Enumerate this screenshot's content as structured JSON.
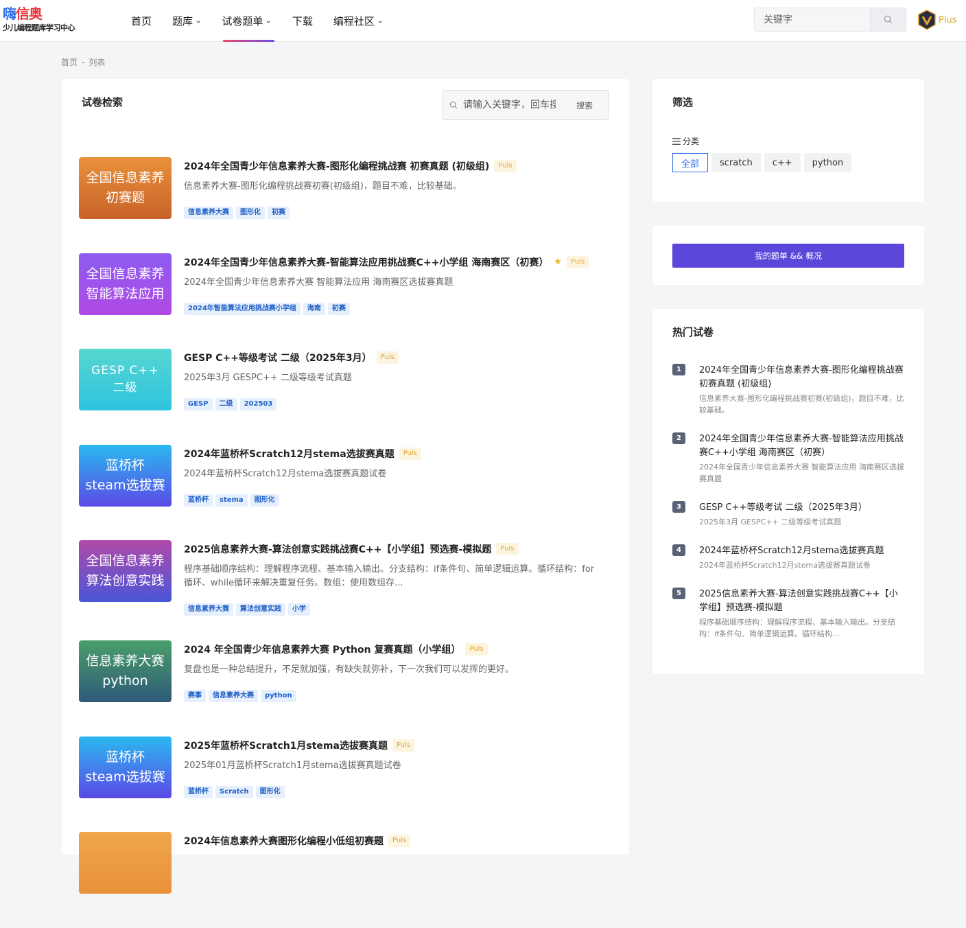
{
  "header": {
    "logo_main_1": "嗨",
    "logo_main_2": "信奥",
    "logo_sub": "少儿编程题库学习中心",
    "nav": [
      {
        "label": "首页",
        "has_menu": false
      },
      {
        "label": "题库",
        "has_menu": true
      },
      {
        "label": "试卷题单",
        "has_menu": true
      },
      {
        "label": "下载",
        "has_menu": false
      },
      {
        "label": "编程社区",
        "has_menu": true
      }
    ],
    "search_placeholder": "关键字",
    "plus_label": "Plus"
  },
  "breadcrumb": {
    "home": "首页",
    "sep": "-",
    "current": "列表"
  },
  "main": {
    "title": "试卷检索",
    "search_placeholder": "请输入关键字，回车搜",
    "search_button": "搜索",
    "items": [
      {
        "thumb": [
          "全国信息素养",
          "初赛题"
        ],
        "title": "2024年全国青少年信息素养大赛-图形化编程挑战赛 初赛真题 (初级组)",
        "badge": "Puls",
        "star": false,
        "desc": "信息素养大赛-图形化编程挑战赛初赛(初级组)，题目不难，比较基础。",
        "tags": [
          "信息素养大赛",
          "图形化",
          "初赛"
        ]
      },
      {
        "thumb": [
          "全国信息素养",
          "智能算法应用"
        ],
        "title": "2024年全国青少年信息素养大赛-智能算法应用挑战赛C++小学组 海南赛区（初赛）",
        "badge": "Puls",
        "star": true,
        "desc": "2024年全国青少年信息素养大赛 智能算法应用 海南赛区选拔赛真题",
        "tags": [
          "2024年智能算法应用挑战赛小学组",
          "海南",
          "初赛"
        ]
      },
      {
        "thumb": [
          "GESP C++",
          "二级"
        ],
        "title": "GESP C++等级考试 二级（2025年3月）",
        "badge": "Puls",
        "star": false,
        "desc": "2025年3月 GESPC++ 二级等级考试真题",
        "tags": [
          "GESP",
          "二级",
          "202503"
        ]
      },
      {
        "thumb": [
          "蓝桥杯",
          "steam选拔赛"
        ],
        "title": "2024年蓝桥杯Scratch12月stema选拔赛真题",
        "badge": "Puls",
        "star": false,
        "desc": "2024年蓝桥杯Scratch12月stema选拔赛真题试卷",
        "tags": [
          "蓝桥杯",
          "stema",
          "图形化"
        ]
      },
      {
        "thumb": [
          "全国信息素养",
          "算法创意实践"
        ],
        "title": "2025信息素养大赛-算法创意实践挑战赛C++【小学组】预选赛-模拟题",
        "badge": "Puls",
        "star": false,
        "desc": "程序基础顺序结构：理解程序流程、基本输入输出。分支结构：if条件句、简单逻辑运算。循环结构：for循环、while循环来解决重复任务。数组：使用数组存...",
        "tags": [
          "信息素养大赛",
          "算法创意实践",
          "小学"
        ]
      },
      {
        "thumb": [
          "信息素养大赛",
          "python"
        ],
        "title": "2024 年全国青少年信息素养大赛 Python 复赛真题（小学组）",
        "badge": "Puls",
        "star": false,
        "desc": "复盘也是一种总结提升，不足就加强，有缺失就弥补，下一次我们可以发挥的更好。",
        "tags": [
          "赛事",
          "信息素养大赛",
          "python"
        ]
      },
      {
        "thumb": [
          "蓝桥杯",
          "steam选拔赛"
        ],
        "title": "2025年蓝桥杯Scratch1月stema选拔赛真题",
        "badge": "Puls",
        "star": false,
        "desc": "2025年01月蓝桥杯Scratch1月stema选拔赛真题试卷",
        "tags": [
          "蓝桥杯",
          "Scratch",
          "图形化"
        ]
      },
      {
        "thumb": [
          "",
          ""
        ],
        "title": "2024年信息素养大赛图形化编程小低组初赛题",
        "badge": "Puls",
        "star": false,
        "desc": "",
        "tags": []
      }
    ]
  },
  "filter": {
    "title": "筛选",
    "category_label": "分类",
    "options": [
      "全部",
      "scratch",
      "c++",
      "python"
    ],
    "selected": "全部"
  },
  "my_list_button": "我的题单 && 概况",
  "hot": {
    "title": "热门试卷",
    "items": [
      {
        "num": "1",
        "title": "2024年全国青少年信息素养大赛-图形化编程挑战赛 初赛真题 (初级组)",
        "desc": "信息素养大赛-图形化编程挑战赛初赛(初级组)，题目不难，比较基础。"
      },
      {
        "num": "2",
        "title": "2024年全国青少年信息素养大赛-智能算法应用挑战赛C++小学组 海南赛区（初赛）",
        "desc": "2024年全国青少年信息素养大赛 智能算法应用 海南赛区选拔赛真题"
      },
      {
        "num": "3",
        "title": "GESP C++等级考试 二级（2025年3月）",
        "desc": "2025年3月 GESPC++ 二级等级考试真题"
      },
      {
        "num": "4",
        "title": "2024年蓝桥杯Scratch12月stema选拔赛真题",
        "desc": "2024年蓝桥杯Scratch12月stema选拔赛真题试卷"
      },
      {
        "num": "5",
        "title": "2025信息素养大赛-算法创意实践挑战赛C++【小学组】预选赛-模拟题",
        "desc": "程序基础顺序结构：理解程序流程、基本输入输出。分支结构：if条件句、简单逻辑运算。循环结构..."
      }
    ]
  },
  "colors": {
    "accent": "#2f6fe6",
    "button_purple": "#5b47d9",
    "badge_gold": "#e0a82a",
    "thumb_gradients": [
      "#e8913a,#c9622a",
      "#8c5cf0,#b04ae6",
      "#56d6d0,#2ec4e0",
      "#2bb8f0,#5a4ae6",
      "#b04aa8,#4a56d8",
      "#4a9e6a,#2e5a78",
      "#2bb8f0,#5a4ae6",
      "#f0a64a,#e8913a"
    ]
  }
}
